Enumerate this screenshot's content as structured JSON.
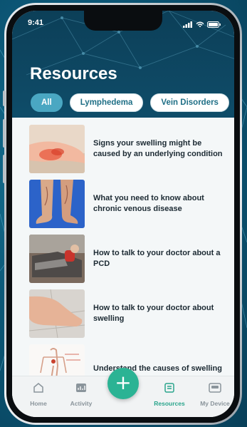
{
  "status_bar": {
    "time": "9:41"
  },
  "page": {
    "title": "Resources"
  },
  "filters": [
    {
      "label": "All",
      "active": true
    },
    {
      "label": "Lymphedema",
      "active": false
    },
    {
      "label": "Vein Disorders",
      "active": false
    }
  ],
  "articles": [
    {
      "title": "Signs your swelling might be caused by an underlying condition",
      "thumb": "leg-swelling-photo"
    },
    {
      "title": "What you need to know about chronic venous disease",
      "thumb": "legs-varicose-photo"
    },
    {
      "title": "How to talk to your doctor about a PCD",
      "thumb": "patient-recliner-photo"
    },
    {
      "title": "How to talk to your doctor about swelling",
      "thumb": "swollen-foot-photo"
    },
    {
      "title": "Understand the causes of swelling",
      "thumb": "anatomy-diagram"
    }
  ],
  "tabbar": {
    "home": "Home",
    "activity": "Activity",
    "add": "+",
    "resources": "Resources",
    "device": "My Device"
  },
  "colors": {
    "accent": "#2bb394",
    "header": "#0c3f58",
    "chip_active": "#4aa7c2"
  }
}
